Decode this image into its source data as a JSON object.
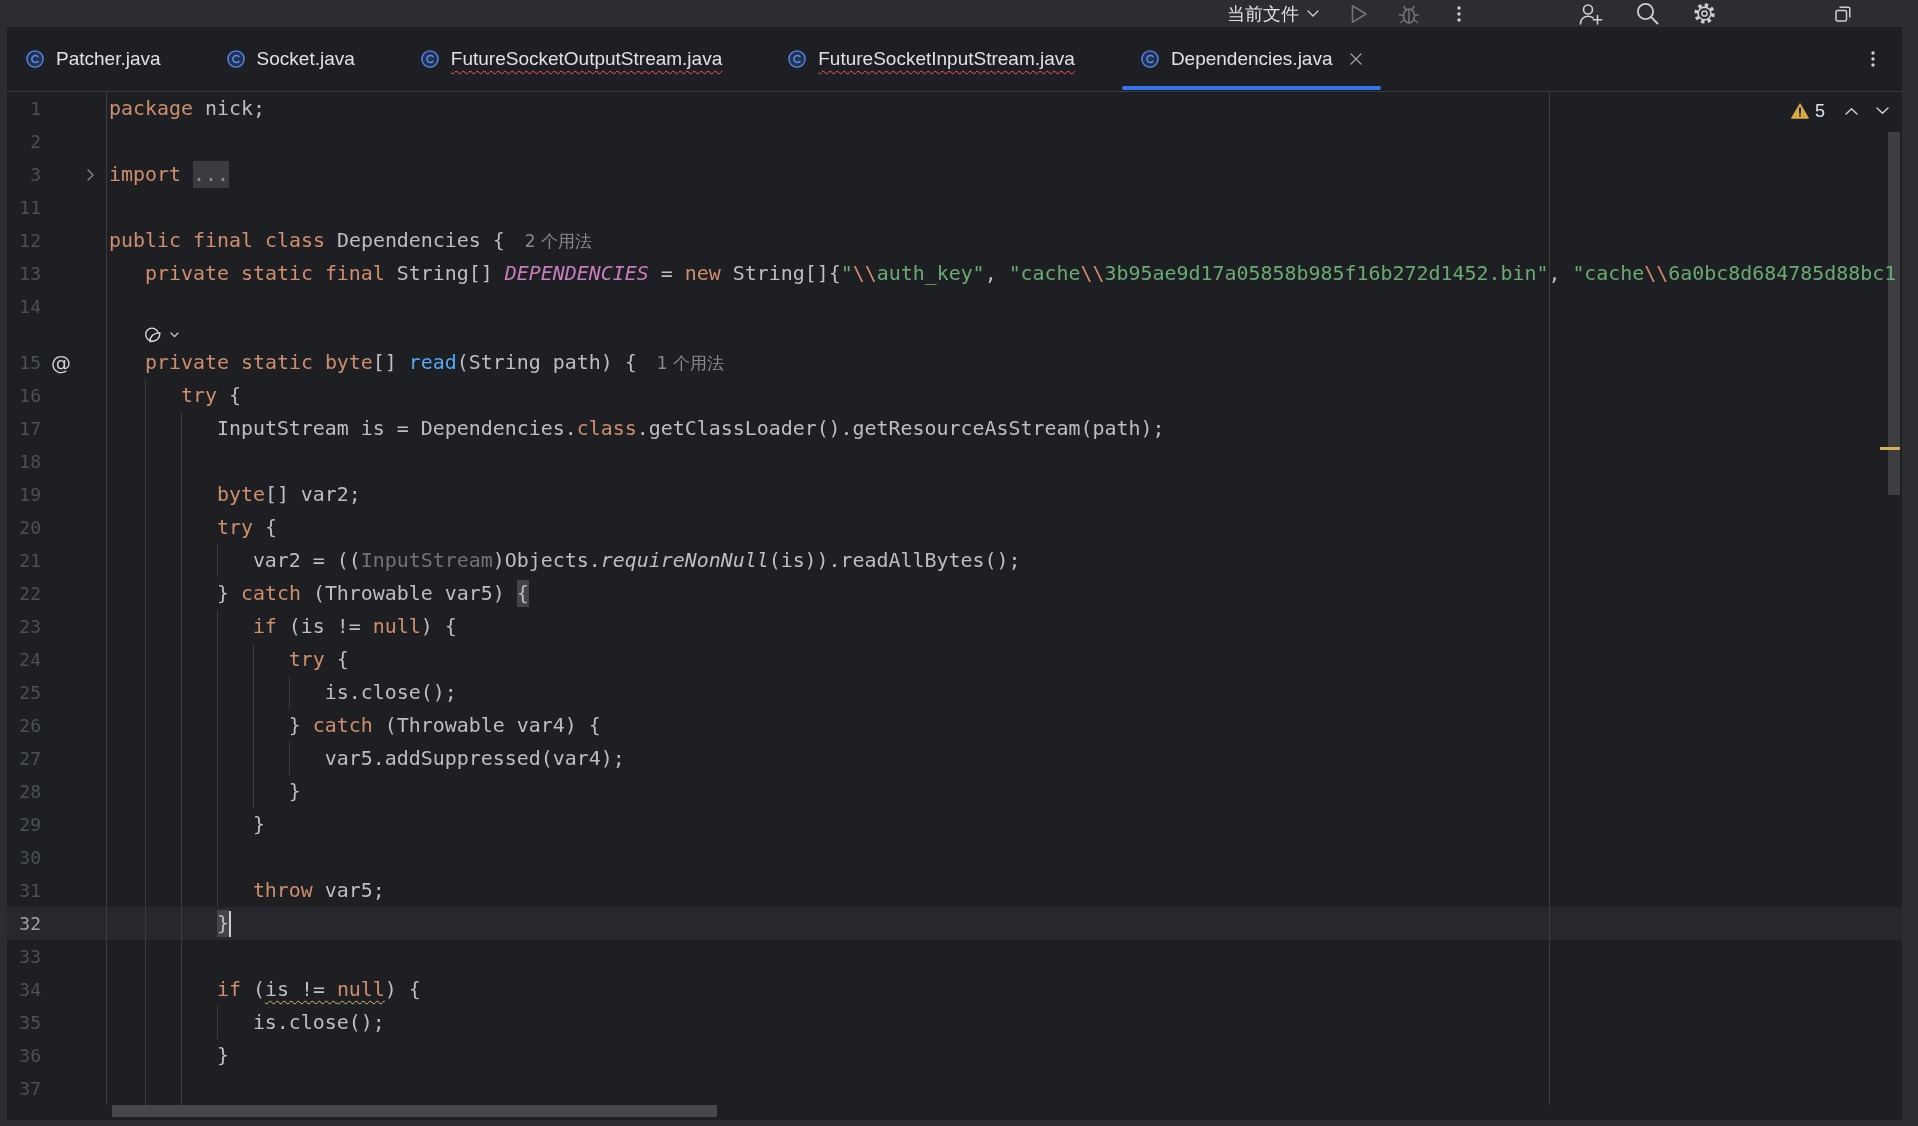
{
  "toolbar": {
    "run_configuration": "当前文件"
  },
  "tabs": [
    {
      "label": "Patcher.java",
      "selected": false,
      "error": false
    },
    {
      "label": "Socket.java",
      "selected": false,
      "error": false
    },
    {
      "label": "FutureSocketOutputStream.java",
      "selected": false,
      "error": true
    },
    {
      "label": "FutureSocketInputStream.java",
      "selected": false,
      "error": true
    },
    {
      "label": "Dependencies.java",
      "selected": true,
      "error": false
    }
  ],
  "editor": {
    "problems": {
      "warnings": "5"
    },
    "lines": [
      {
        "kind": "code",
        "number": "1",
        "current": false,
        "tokens": [
          {
            "kind": "keyword",
            "text": "package"
          },
          {
            "kind": "plain",
            "text": " nick;"
          }
        ]
      },
      {
        "kind": "code",
        "number": "2",
        "current": false
      },
      {
        "kind": "code",
        "number": "3",
        "current": false,
        "gutter": {
          "kind": "fold",
          "expanded": false
        },
        "tokens": [
          {
            "kind": "keyword",
            "text": "import "
          },
          {
            "kind": "fold-placeholder",
            "text": "..."
          }
        ]
      },
      {
        "kind": "code",
        "number": "11",
        "current": false
      },
      {
        "kind": "code",
        "number": "12",
        "current": false,
        "tokens": [
          {
            "kind": "keyword",
            "text": "public final class"
          },
          {
            "kind": "plain",
            "text": " Dependencies {"
          },
          {
            "kind": "hint",
            "text": "2 个用法"
          }
        ]
      },
      {
        "kind": "code",
        "number": "13",
        "current": false,
        "tokens": [
          {
            "kind": "keyword",
            "text": "   private static final"
          },
          {
            "kind": "plain",
            "text": " String[] "
          },
          {
            "kind": "field",
            "text": "DEPENDENCIES"
          },
          {
            "kind": "plain",
            "text": " = "
          },
          {
            "kind": "keyword",
            "text": "new"
          },
          {
            "kind": "plain",
            "text": " String[]{"
          },
          {
            "kind": "string",
            "text": "\""
          },
          {
            "kind": "escape",
            "text": "\\\\"
          },
          {
            "kind": "string",
            "text": "auth_key\""
          },
          {
            "kind": "plain",
            "text": ", "
          },
          {
            "kind": "string",
            "text": "\"cache"
          },
          {
            "kind": "escape",
            "text": "\\\\"
          },
          {
            "kind": "string",
            "text": "3b95ae9d17a05858b985f16b272d1452.bin\""
          },
          {
            "kind": "plain",
            "text": ", "
          },
          {
            "kind": "string",
            "text": "\"cache"
          },
          {
            "kind": "escape",
            "text": "\\\\"
          },
          {
            "kind": "string",
            "text": "6a0bc8d684785d88bc1"
          }
        ]
      },
      {
        "kind": "code",
        "number": "14",
        "current": false
      },
      {
        "kind": "lens"
      },
      {
        "kind": "code",
        "number": "15",
        "current": false,
        "gutter": {
          "kind": "mark",
          "text": "@"
        },
        "tokens": [
          {
            "kind": "keyword",
            "text": "   private static byte"
          },
          {
            "kind": "plain",
            "text": "[] "
          },
          {
            "kind": "method",
            "text": "read"
          },
          {
            "kind": "plain",
            "text": "(String path) {"
          },
          {
            "kind": "hint",
            "text": "1 个用法"
          }
        ]
      },
      {
        "kind": "code",
        "number": "16",
        "current": false,
        "tokens": [
          {
            "kind": "keyword",
            "text": "      try"
          },
          {
            "kind": "plain",
            "text": " {"
          }
        ]
      },
      {
        "kind": "code",
        "number": "17",
        "current": false,
        "tokens": [
          {
            "kind": "plain",
            "text": "         InputStream is = Dependencies."
          },
          {
            "kind": "keyword",
            "text": "class"
          },
          {
            "kind": "plain",
            "text": ".getClassLoader().getResourceAsStream(path);"
          }
        ]
      },
      {
        "kind": "code",
        "number": "18",
        "current": false
      },
      {
        "kind": "code",
        "number": "19",
        "current": false,
        "tokens": [
          {
            "kind": "keyword",
            "text": "         byte"
          },
          {
            "kind": "plain",
            "text": "[] var2;"
          }
        ]
      },
      {
        "kind": "code",
        "number": "20",
        "current": false,
        "tokens": [
          {
            "kind": "keyword",
            "text": "         try"
          },
          {
            "kind": "plain",
            "text": " {"
          }
        ]
      },
      {
        "kind": "code",
        "number": "21",
        "current": false,
        "tokens": [
          {
            "kind": "plain",
            "text": "            var2 = (("
          },
          {
            "kind": "redundant",
            "text": "InputStream"
          },
          {
            "kind": "plain",
            "text": ")Objects."
          },
          {
            "kind": "static-call",
            "text": "requireNonNull"
          },
          {
            "kind": "plain",
            "text": "(is)).readAllBytes();"
          }
        ]
      },
      {
        "kind": "code",
        "number": "22",
        "current": false,
        "tokens": [
          {
            "kind": "plain",
            "text": "         } "
          },
          {
            "kind": "keyword",
            "text": "catch"
          },
          {
            "kind": "plain",
            "text": " (Throwable var5) "
          },
          {
            "kind": "brace-match",
            "text": "{"
          }
        ]
      },
      {
        "kind": "code",
        "number": "23",
        "current": false,
        "tokens": [
          {
            "kind": "keyword",
            "text": "            if"
          },
          {
            "kind": "plain",
            "text": " (is != "
          },
          {
            "kind": "keyword",
            "text": "null"
          },
          {
            "kind": "plain",
            "text": ") {"
          }
        ]
      },
      {
        "kind": "code",
        "number": "24",
        "current": false,
        "tokens": [
          {
            "kind": "keyword",
            "text": "               try"
          },
          {
            "kind": "plain",
            "text": " {"
          }
        ]
      },
      {
        "kind": "code",
        "number": "25",
        "current": false,
        "tokens": [
          {
            "kind": "plain",
            "text": "                  is.close();"
          }
        ]
      },
      {
        "kind": "code",
        "number": "26",
        "current": false,
        "tokens": [
          {
            "kind": "plain",
            "text": "               } "
          },
          {
            "kind": "keyword",
            "text": "catch"
          },
          {
            "kind": "plain",
            "text": " (Throwable var4) {"
          }
        ]
      },
      {
        "kind": "code",
        "number": "27",
        "current": false,
        "tokens": [
          {
            "kind": "plain",
            "text": "                  var5.addSuppressed(var4);"
          }
        ]
      },
      {
        "kind": "code",
        "number": "28",
        "current": false,
        "tokens": [
          {
            "kind": "plain",
            "text": "               }"
          }
        ]
      },
      {
        "kind": "code",
        "number": "29",
        "current": false,
        "tokens": [
          {
            "kind": "plain",
            "text": "            }"
          }
        ]
      },
      {
        "kind": "code",
        "number": "30",
        "current": false
      },
      {
        "kind": "code",
        "number": "31",
        "current": false,
        "tokens": [
          {
            "kind": "keyword",
            "text": "            throw"
          },
          {
            "kind": "plain",
            "text": " var5;"
          }
        ]
      },
      {
        "kind": "code",
        "number": "32",
        "current": true,
        "tokens": [
          {
            "kind": "brace-match",
            "text": "         }"
          },
          {
            "kind": "caret"
          }
        ]
      },
      {
        "kind": "code",
        "number": "33",
        "current": false
      },
      {
        "kind": "code",
        "number": "34",
        "current": false,
        "tokens": [
          {
            "kind": "keyword",
            "text": "         if"
          },
          {
            "kind": "plain",
            "text": " ("
          },
          {
            "kind": "warning",
            "tokens": [
              {
                "kind": "plain",
                "text": "is != "
              },
              {
                "kind": "keyword",
                "text": "null"
              }
            ]
          },
          {
            "kind": "plain",
            "text": ") {"
          }
        ]
      },
      {
        "kind": "code",
        "number": "35",
        "current": false,
        "tokens": [
          {
            "kind": "plain",
            "text": "            is.close();"
          }
        ]
      },
      {
        "kind": "code",
        "number": "36",
        "current": false,
        "tokens": [
          {
            "kind": "plain",
            "text": "         }"
          }
        ]
      },
      {
        "kind": "code",
        "number": "37",
        "current": false
      }
    ]
  }
}
